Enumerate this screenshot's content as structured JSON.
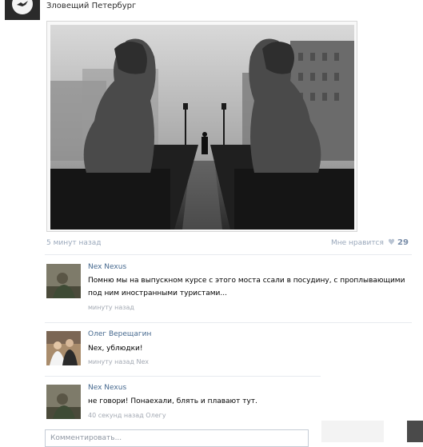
{
  "group": {
    "name": "Зловещий Петербург"
  },
  "post": {
    "time": "5 минут назад",
    "like_label": "Мне нравится",
    "like_icon": "heart-icon",
    "like_count": "29"
  },
  "comments": [
    {
      "author": "Nex Nexus",
      "text_line1": "Помню мы на выпускном курсе с этого моста ссали в посудину, с проплывающими",
      "text_line2": "под ним иностранными туристами...",
      "time": "минуту назад"
    },
    {
      "author": "Олег Верещагин",
      "text": "Nex, ублюдки!",
      "time": "минуту назад Nex"
    },
    {
      "author": "Nex Nexus",
      "text": "не говори! Понаехали, блять и плавают тут.",
      "time": "40 секунд назад Олегу"
    }
  ],
  "input": {
    "placeholder": "Комментировать..."
  }
}
